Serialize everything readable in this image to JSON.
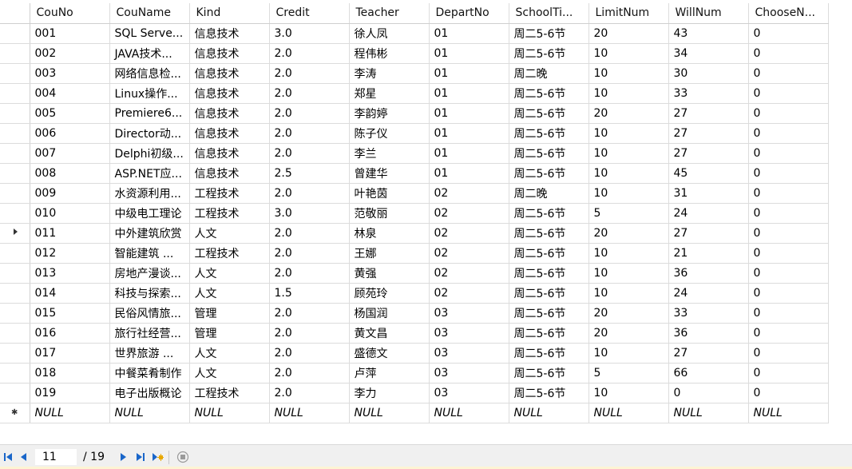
{
  "grid": {
    "columns": [
      "CouNo",
      "CouName",
      "Kind",
      "Credit",
      "Teacher",
      "DepartNo",
      "SchoolTi...",
      "LimitNum",
      "WillNum",
      "ChooseN..."
    ],
    "rows": [
      [
        "001",
        "SQL Serve...",
        "信息技术",
        "3.0",
        "徐人凤",
        "01",
        "周二5-6节",
        "20",
        "43",
        "0"
      ],
      [
        "002",
        "JAVA技术...",
        "信息技术",
        "2.0",
        "程伟彬",
        "01",
        "周二5-6节",
        "10",
        "34",
        "0"
      ],
      [
        "003",
        "网络信息检...",
        "信息技术",
        "2.0",
        "李涛",
        "01",
        "周二晚",
        "10",
        "30",
        "0"
      ],
      [
        "004",
        "Linux操作...",
        "信息技术",
        "2.0",
        "郑星",
        "01",
        "周二5-6节",
        "10",
        "33",
        "0"
      ],
      [
        "005",
        "Premiere6...",
        "信息技术",
        "2.0",
        "李韵婷",
        "01",
        "周二5-6节",
        "20",
        "27",
        "0"
      ],
      [
        "006",
        "Director动...",
        "信息技术",
        "2.0",
        "陈子仪",
        "01",
        "周二5-6节",
        "10",
        "27",
        "0"
      ],
      [
        "007",
        "Delphi初级...",
        "信息技术",
        "2.0",
        "李兰",
        "01",
        "周二5-6节",
        "10",
        "27",
        "0"
      ],
      [
        "008",
        "ASP.NET应...",
        "信息技术",
        "2.5",
        "曾建华",
        "01",
        "周二5-6节",
        "10",
        "45",
        "0"
      ],
      [
        "009",
        "水资源利用...",
        "工程技术",
        "2.0",
        "叶艳茵",
        "02",
        "周二晚",
        "10",
        "31",
        "0"
      ],
      [
        "010",
        "中级电工理论",
        "工程技术",
        "3.0",
        "范敬丽",
        "02",
        "周二5-6节",
        "5",
        "24",
        "0"
      ],
      [
        "011",
        "中外建筑欣赏",
        "人文",
        "2.0",
        "林泉",
        "02",
        "周二5-6节",
        "20",
        "27",
        "0"
      ],
      [
        "012",
        "智能建筑    ...",
        "工程技术",
        "2.0",
        "王娜",
        "02",
        "周二5-6节",
        "10",
        "21",
        "0"
      ],
      [
        "013",
        "房地产漫谈...",
        "人文",
        "2.0",
        "黄强",
        "02",
        "周二5-6节",
        "10",
        "36",
        "0"
      ],
      [
        "014",
        "科技与探索...",
        "人文",
        "1.5",
        "顾苑玲",
        "02",
        "周二5-6节",
        "10",
        "24",
        "0"
      ],
      [
        "015",
        "民俗风情旅...",
        "管理",
        "2.0",
        "杨国润",
        "03",
        "周二5-6节",
        "20",
        "33",
        "0"
      ],
      [
        "016",
        "旅行社经营...",
        "管理",
        "2.0",
        "黄文昌",
        "03",
        "周二5-6节",
        "20",
        "36",
        "0"
      ],
      [
        "017",
        "世界旅游    ...",
        "人文",
        "2.0",
        "盛德文",
        "03",
        "周二5-6节",
        "10",
        "27",
        "0"
      ],
      [
        "018",
        "中餐菜肴制作",
        "人文",
        "2.0",
        "卢萍",
        "03",
        "周二5-6节",
        "5",
        "66",
        "0"
      ],
      [
        "019",
        "电子出版概论",
        "工程技术",
        "2.0",
        "李力",
        "03",
        "周二5-6节",
        "10",
        "0",
        "0"
      ]
    ],
    "new_row": [
      "NULL",
      "NULL",
      "NULL",
      "NULL",
      "NULL",
      "NULL",
      "NULL",
      "NULL",
      "NULL",
      "NULL"
    ],
    "current_row_index": 10
  },
  "navigator": {
    "position": "11",
    "total": "/ 19",
    "icons": [
      "first-record-icon",
      "previous-record-icon",
      "next-record-icon",
      "last-record-icon",
      "new-record-icon",
      "cancel-icon"
    ]
  },
  "colors": {
    "nav_blue": "#1a66c9",
    "new_record_star": "#e8a800",
    "disabled_gray": "#9a9a9a"
  }
}
